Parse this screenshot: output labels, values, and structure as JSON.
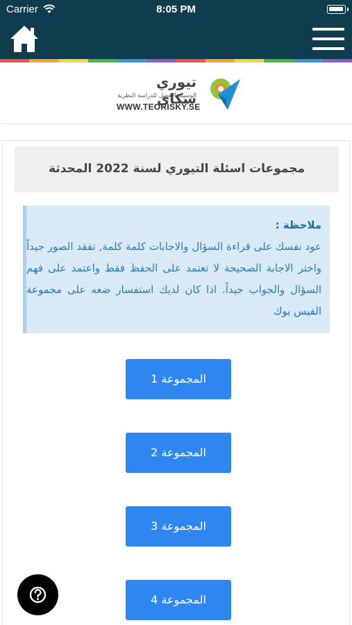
{
  "status_bar": {
    "carrier": "Carrier",
    "time": "8:05 PM"
  },
  "header": {
    "home_icon": "home-icon",
    "menu_icon": "hamburger-menu-icon",
    "background_color": "#0f3d4e",
    "rainbow_colors": [
      "#e8554e",
      "#f2a33a",
      "#f5d33f",
      "#4cb848",
      "#3a9ad9",
      "#8e5cc9",
      "#e8554e",
      "#f2a33a",
      "#f5d33f",
      "#4cb848",
      "#3a9ad9",
      "#8e5cc9"
    ]
  },
  "logo": {
    "title": "تيوري سكاي",
    "subtitle": "الوسيلة الافضل للدراسة النظرية",
    "url": "WWW.TEORISKY.SE"
  },
  "main": {
    "title": "مجموعات اسئلة التيوري لسنة 2022 المحدثة",
    "note": {
      "title": "ملاحظة :",
      "body": "عود نفسك على قراءة السؤال والاجابات كلمة كلمة, تفقد الصور جيداً واختر الاجابة الصحيحة لا تعتمد على الحفظ فقط واعتمد على فهم السؤال والجواب جيداً. اذا كان لديك استفسار ضعه على",
      "link_text": "مجموعة الفيس بوك"
    },
    "groups": [
      {
        "label": "المجموعة 1"
      },
      {
        "label": "المجموعة 2"
      },
      {
        "label": "المجموعة 3"
      },
      {
        "label": "المجموعة 4"
      }
    ],
    "accent_color": "#2e86f0"
  },
  "help_button": {
    "icon": "question-circle-icon"
  }
}
